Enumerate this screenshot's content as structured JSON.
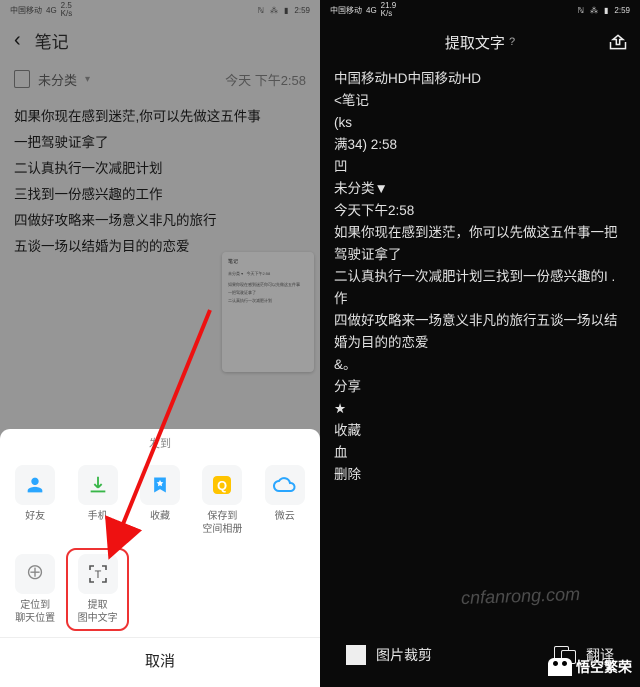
{
  "left": {
    "status": {
      "carrier": "中国移动",
      "net": "4G",
      "speed": "2.5\nK/s",
      "nfc": "NFC",
      "bt": "BT",
      "time": "2:59"
    },
    "header": {
      "title": "笔记"
    },
    "category": {
      "label": "未分类",
      "time": "今天 下午2:58"
    },
    "note_lines": [
      "如果你现在感到迷茫,你可以先做这五件事",
      "一把驾驶证拿了",
      "二认真执行一次减肥计划",
      "三找到一份感兴趣的工作",
      "四做好攻略来一场意义非凡的旅行",
      "五谈一场以结婚为目的的恋爱"
    ],
    "sheet": {
      "send_label": "发到",
      "row1": [
        {
          "name": "friends",
          "label": "好友",
          "color": "#2aa6ff"
        },
        {
          "name": "phone",
          "label": "手机",
          "color": "#38b648"
        },
        {
          "name": "favorite",
          "label": "收藏",
          "color": "#2aa6ff"
        },
        {
          "name": "qzone",
          "label": "保存到\n空间相册",
          "color": "#ffc400"
        },
        {
          "name": "weiyun",
          "label": "微云",
          "color": "#2aa6ff"
        }
      ],
      "row2": [
        {
          "name": "locate",
          "label": "定位到\n聊天位置"
        },
        {
          "name": "extract-text",
          "label": "提取\n图中文字"
        }
      ],
      "cancel": "取消"
    }
  },
  "right": {
    "status": {
      "carrier": "中国移动",
      "net": "4G",
      "speed": "21.9\nK/s",
      "nfc": "NFC",
      "bt": "BT",
      "time": "2:59"
    },
    "header": {
      "title": "提取文字",
      "help": "?"
    },
    "body_lines": [
      "中国移动HD中国移动HD",
      "<笔记",
      "",
      "(ks",
      "满34) 2:58",
      "凹",
      "未分类▼",
      "今天下午2:58",
      "如果你现在感到迷茫，你可以先做这五件事一把",
      "驾驶证拿了",
      "二认真执行一次减肥计划三找到一份感兴趣的I .",
      "作",
      "四做好攻略来一场意义非凡的旅行五谈一场以结",
      "婚为目的的恋爱",
      "",
      "&。",
      "分享",
      "",
      "★",
      "收藏",
      "",
      "血",
      "删除"
    ],
    "bottom": {
      "crop": "图片裁剪",
      "translate": "翻译"
    }
  },
  "watermarks": {
    "url": "cnfanrong.com",
    "brand": "悟空繁荣"
  }
}
